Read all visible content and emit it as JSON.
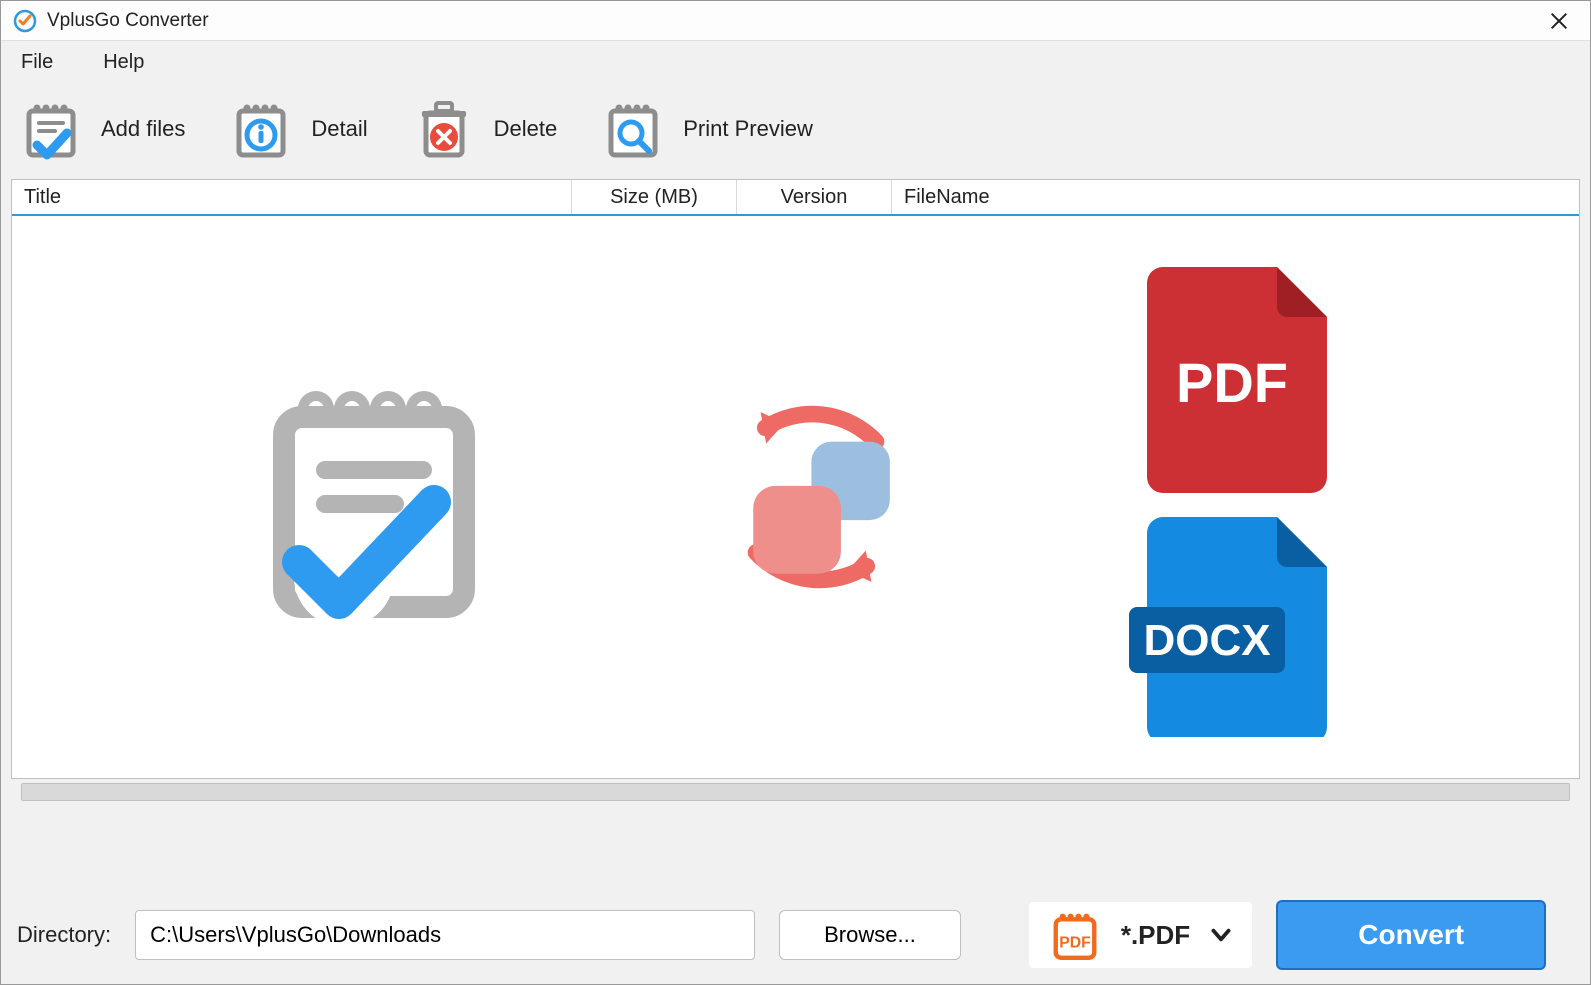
{
  "title": "VplusGo Converter",
  "menu": {
    "file": "File",
    "help": "Help"
  },
  "toolbar": {
    "add_files": "Add files",
    "detail": "Detail",
    "delete": "Delete",
    "print_preview": "Print Preview"
  },
  "columns": {
    "title": "Title",
    "size": "Size (MB)",
    "version": "Version",
    "filename": "FileName"
  },
  "column_widths": {
    "title": 560,
    "size": 165,
    "version": 155,
    "filename": 600
  },
  "directory": {
    "label": "Directory:",
    "value": "C:\\Users\\VplusGo\\Downloads",
    "browse_label": "Browse..."
  },
  "format": {
    "selected": "*.PDF"
  },
  "convert_label": "Convert",
  "placeholder_icons": {
    "pdf_label": "PDF",
    "docx_label": "DOCX"
  }
}
